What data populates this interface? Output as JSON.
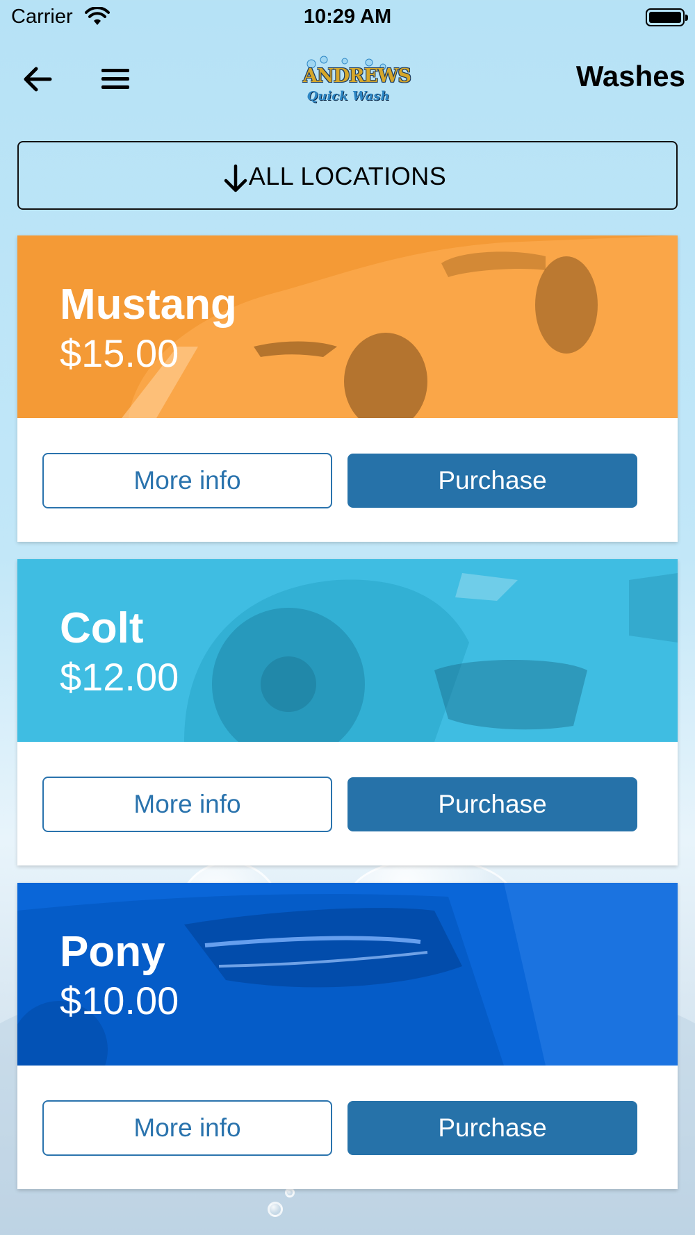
{
  "status_bar": {
    "carrier": "Carrier",
    "time": "10:29 AM"
  },
  "header": {
    "logo_text": "ANDREWS",
    "logo_subtext": "Quick Wash",
    "title": "Washes",
    "icons": [
      "arrow-left-icon",
      "hamburger-menu-icon"
    ]
  },
  "location_selector": {
    "label": "ALL LOCATIONS",
    "icon": "arrow-down-icon"
  },
  "washes": [
    {
      "name": "Mustang",
      "price": "$15.00",
      "more_info_label": "More info",
      "purchase_label": "Purchase",
      "color": "#f49a36"
    },
    {
      "name": "Colt",
      "price": "$12.00",
      "more_info_label": "More info",
      "purchase_label": "Purchase",
      "color": "#3fbde2"
    },
    {
      "name": "Pony",
      "price": "$10.00",
      "more_info_label": "More info",
      "purchase_label": "Purchase",
      "color": "#0a66d8"
    }
  ],
  "colors": {
    "accent": "#2672a9",
    "background": "#b6e2f6"
  }
}
